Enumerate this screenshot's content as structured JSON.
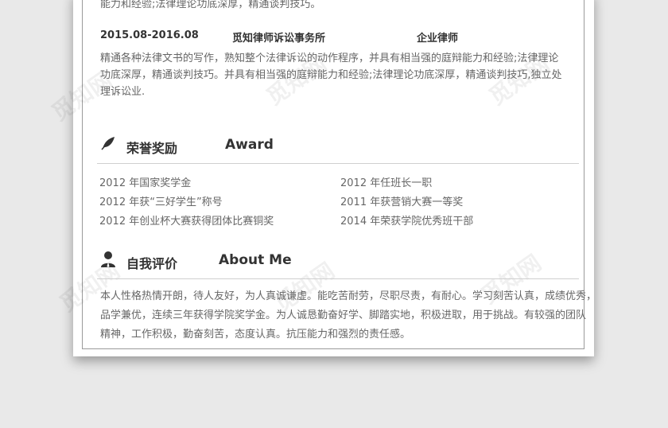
{
  "watermark": "觅知网",
  "experience": {
    "cut_text": "能力和经验;法律理论功底深厚，精通谈判技巧。",
    "job": {
      "date": "2015.08-2016.08",
      "company": "觅知律师诉讼事务所",
      "position": "企业律师",
      "desc_lines": [
        "精通各种法律文书的写作，熟知整个法律诉讼的动作程序，并具有相当强的庭辩能力和经验;法律理论",
        "功底深厚，精通谈判技巧。并具有相当强的庭辩能力和经验;法律理论功底深厚，精通谈判技巧,独立处",
        "理诉讼业."
      ]
    }
  },
  "awards": {
    "title": "荣誉奖励",
    "title_en": "Award",
    "left": [
      "2012 年国家奖学金",
      "2012 年获“三好学生”称号",
      "2012 年创业杯大赛获得团体比赛铜奖"
    ],
    "right": [
      "2012 年任班长一职",
      "2011 年获营销大赛一等奖",
      "2014 年荣获学院优秀班干部"
    ]
  },
  "about": {
    "title": "自我评价",
    "title_en": "About Me",
    "lines": [
      "本人性格热情开朗，待人友好，为人真诚谦虚。能吃苦耐劳，尽职尽责，有耐心。学习刻苦认真，成绩优秀，",
      "品学兼优，连续三年获得学院奖学金。为人诚恳勤奋好学、脚踏实地，积极进取，用于挑战。有较强的团队",
      "精神，工作积极，勤奋刻苦，态度认真。抗压能力和强烈的责任感。"
    ]
  },
  "icons": {
    "award": "leaf-icon",
    "about": "person-icon"
  }
}
